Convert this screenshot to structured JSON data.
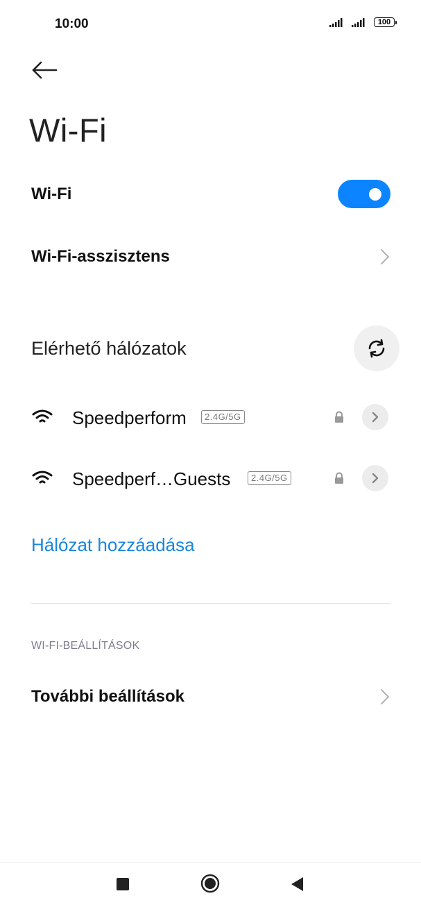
{
  "status_bar": {
    "time": "10:00",
    "battery": "100"
  },
  "header": {
    "title": "Wi-Fi"
  },
  "wifi_toggle": {
    "label": "Wi-Fi",
    "state": "on",
    "color": "#0d84ff"
  },
  "assistant": {
    "label": "Wi-Fi-asszisztens"
  },
  "available": {
    "title": "Elérhető hálózatok"
  },
  "networks": [
    {
      "name": "Speedperform",
      "band": "2.4G/5G",
      "secured": true
    },
    {
      "name": "Speedperf…Guests",
      "band": "2.4G/5G",
      "secured": true
    }
  ],
  "add_network": {
    "label": "Hálózat hozzáadása",
    "color": "#1a86e0"
  },
  "settings_section": {
    "header": "WI-FI-BEÁLLÍTÁSOK",
    "more_label": "További beállítások"
  },
  "nav": {
    "icons": [
      "recents-square-icon",
      "home-circle-icon",
      "back-triangle-icon"
    ]
  }
}
